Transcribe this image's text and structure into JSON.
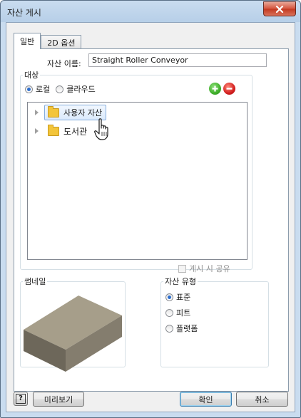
{
  "window": {
    "title": "자산 게시"
  },
  "tabs": [
    {
      "label": "일반",
      "active": true
    },
    {
      "label": "2D 옵션",
      "active": false
    }
  ],
  "asset_name": {
    "label": "자산 이름:",
    "value": "Straight Roller Conveyor"
  },
  "target": {
    "legend": "대상",
    "options": [
      {
        "label": "로컬",
        "checked": true
      },
      {
        "label": "클라우드",
        "checked": false
      }
    ],
    "tree": [
      {
        "label": "사용자 자산",
        "selected": true
      },
      {
        "label": "도서관",
        "selected": false
      }
    ],
    "share_on_publish": {
      "label": "게시 시 공유",
      "checked": false,
      "enabled": false
    }
  },
  "thumbnail": {
    "legend": "썸네일"
  },
  "asset_type": {
    "legend": "자산 유형",
    "options": [
      {
        "label": "표준",
        "checked": true
      },
      {
        "label": "피트",
        "checked": false
      },
      {
        "label": "플랫폼",
        "checked": false
      }
    ]
  },
  "footer": {
    "help_label": "?",
    "preview_label": "미리보기",
    "ok_label": "확인",
    "cancel_label": "취소"
  },
  "colors": {
    "add_button": "#3fae2a",
    "remove_button": "#d21f1f",
    "folder": "#f3c53a",
    "selection": "#dbeafc",
    "box_top": "#a69e8a",
    "box_left": "#6d675a",
    "box_right": "#847d6e"
  },
  "icons": {
    "add": "plus-circle-icon",
    "remove": "minus-circle-icon",
    "cursor": "hand-pointer-icon",
    "close": "close-icon",
    "help": "help-icon",
    "folder": "folder-icon"
  }
}
